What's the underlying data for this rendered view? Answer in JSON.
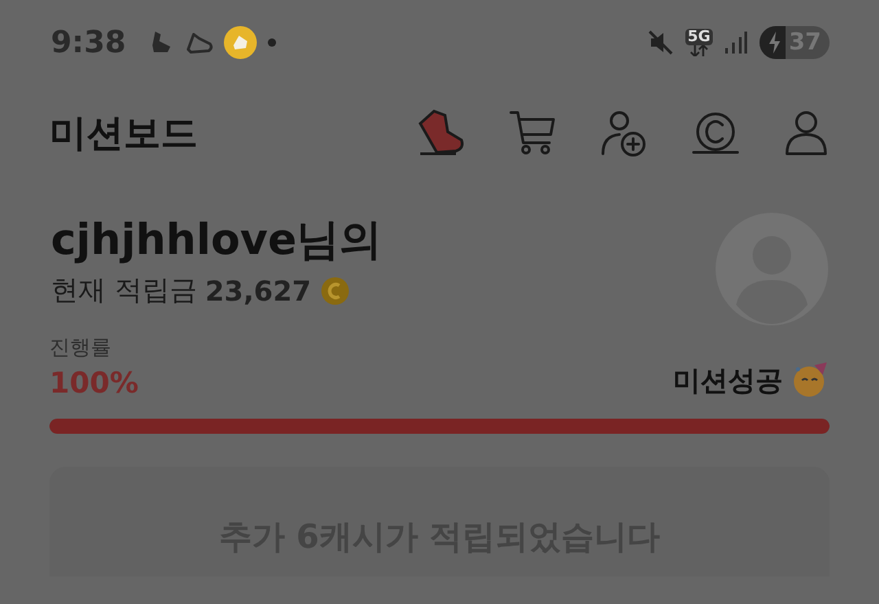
{
  "status_bar": {
    "time": "9:38",
    "network": "5G",
    "battery": "37"
  },
  "header": {
    "title": "미션보드"
  },
  "profile": {
    "name": "cjhjhhlove님의",
    "balance_label": "현재 적립금",
    "balance": "23,627"
  },
  "progress": {
    "label": "진행률",
    "percent": "100%",
    "level": 1,
    "status": "미션성공"
  },
  "notice": {
    "label": "추가 6캐시가 적립되었습니다"
  }
}
